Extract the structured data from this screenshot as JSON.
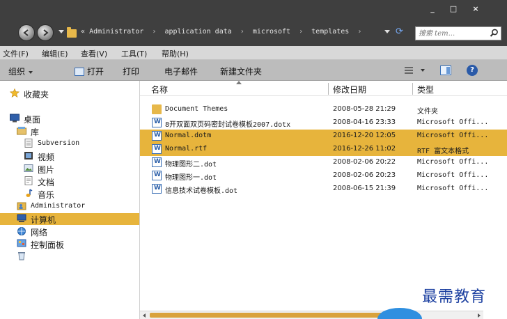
{
  "window": {
    "controls": [
      "_",
      "□",
      "×"
    ]
  },
  "address": {
    "overflow": "«",
    "crumbs": [
      "Administrator",
      "application data",
      "microsoft",
      "templates"
    ],
    "trailing_sep": "›",
    "search_placeholder": "搜索 tem..."
  },
  "menu": [
    "文件(F)",
    "编辑(E)",
    "查看(V)",
    "工具(T)",
    "帮助(H)"
  ],
  "toolbar": {
    "organize": "组织",
    "open": "打开",
    "print": "打印",
    "email": "电子邮件",
    "new_folder": "新建文件夹"
  },
  "sidebar": {
    "favorites": "收藏夹",
    "desktop": "桌面",
    "libraries": "库",
    "subversion": "Subversion",
    "videos": "视频",
    "pictures": "图片",
    "documents": "文档",
    "music": "音乐",
    "administrator": "Administrator",
    "computer": "计算机",
    "network": "网络",
    "control_panel": "控制面板"
  },
  "columns": {
    "name": "名称",
    "date": "修改日期",
    "type": "类型"
  },
  "files": [
    {
      "name": "Document Themes",
      "date": "2008-05-28 21:29",
      "type": "文件夹",
      "icon": "folder-icon",
      "selected": false
    },
    {
      "name": "8开双面双页码密封试卷模板2007.dotx",
      "date": "2008-04-16 23:33",
      "type": "Microsoft Offi...",
      "icon": "word-template-icon",
      "selected": false
    },
    {
      "name": "Normal.dotm",
      "date": "2016-12-20 12:05",
      "type": "Microsoft Offi...",
      "icon": "word-template-icon",
      "selected": true
    },
    {
      "name": "Normal.rtf",
      "date": "2016-12-26 11:02",
      "type": "RTF 富文本格式",
      "icon": "word-document-icon",
      "selected": true
    },
    {
      "name": "物理图形二.dot",
      "date": "2008-02-06 20:22",
      "type": "Microsoft Offi...",
      "icon": "word-template-icon",
      "selected": false
    },
    {
      "name": "物理图形一.dot",
      "date": "2008-02-06 20:23",
      "type": "Microsoft Offi...",
      "icon": "word-template-icon",
      "selected": false
    },
    {
      "name": "信息技术试卷模板.dot",
      "date": "2008-06-15 21:39",
      "type": "Microsoft Offi...",
      "icon": "word-template-icon",
      "selected": false
    }
  ],
  "watermark": "最需教育",
  "colors": {
    "titlebar": "#3f3f3f",
    "selection": "#e7b43c",
    "toolbar": "#bcbcbc",
    "menubar": "#d8d8d8"
  }
}
